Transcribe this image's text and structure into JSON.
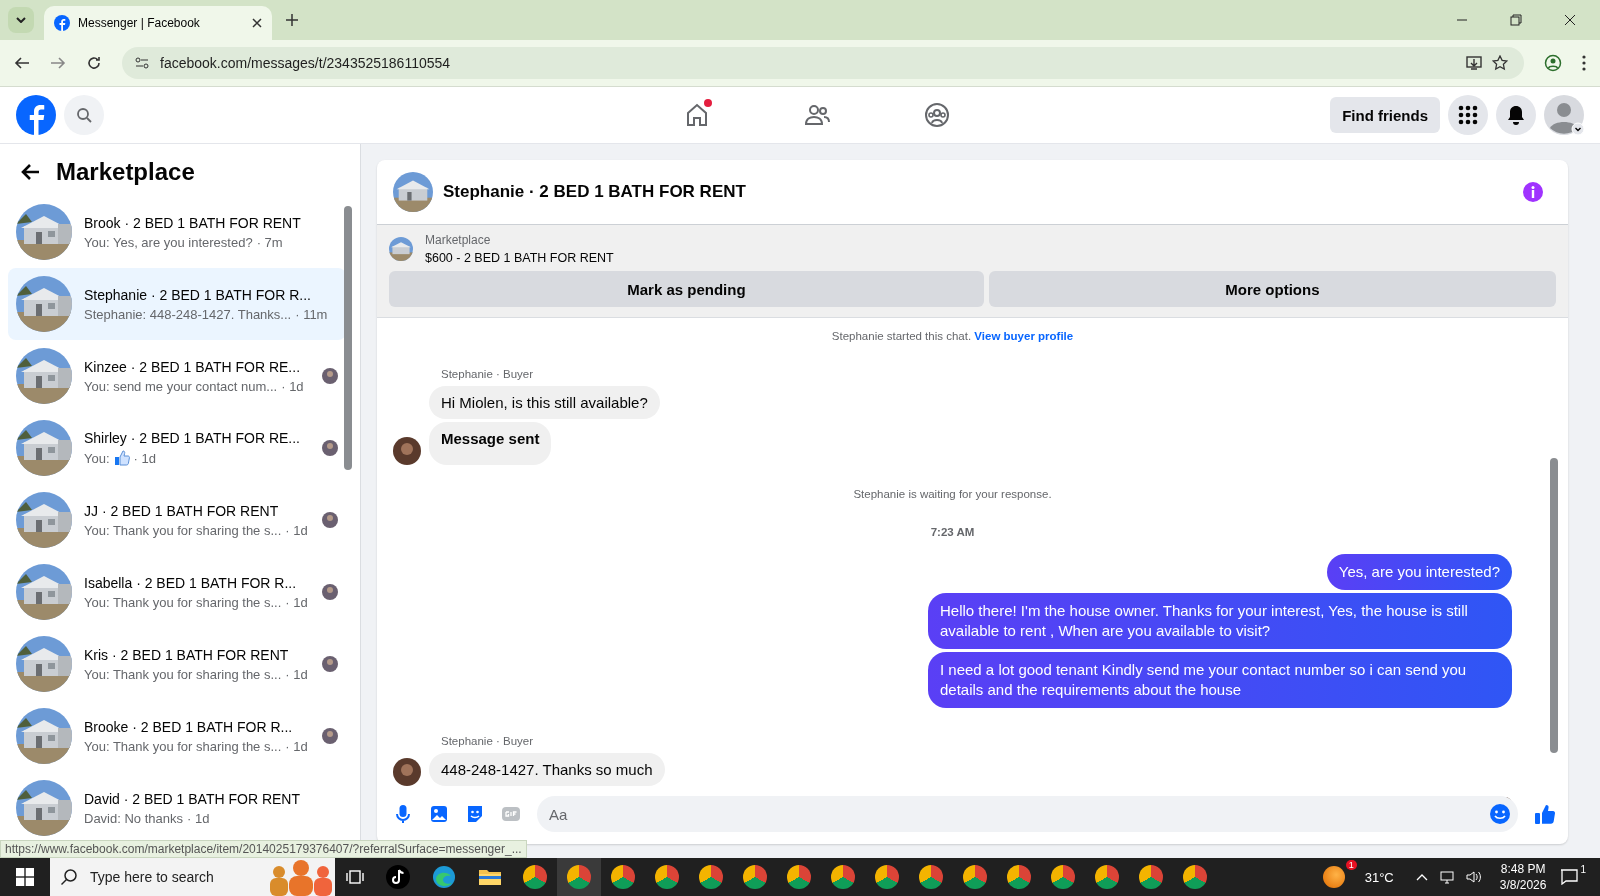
{
  "browser": {
    "tab_title": "Messenger | Facebook",
    "url": "facebook.com/messages/t/2343525186110554"
  },
  "header": {
    "home_badge": true,
    "find_friends": "Find friends"
  },
  "sidebar": {
    "title": "Marketplace",
    "conversations": [
      {
        "name": "Brook · 2 BED 1 BATH FOR RENT",
        "kind": "text",
        "preview": "You: Yes, are you interested?",
        "time": "· 7m",
        "selected": false,
        "seen": false
      },
      {
        "name": "Stephanie · 2 BED 1 BATH FOR R...",
        "kind": "text",
        "preview": "Stephanie: 448-248-1427. Thanks...",
        "time": "· 11m",
        "selected": true,
        "seen": false
      },
      {
        "name": "Kinzee · 2 BED 1 BATH FOR RE...",
        "kind": "text",
        "preview": "You: send me your contact num...",
        "time": "· 1d",
        "selected": false,
        "seen": true
      },
      {
        "name": "Shirley · 2 BED 1 BATH FOR RE...",
        "kind": "like",
        "preview": "You:",
        "time": "· 1d",
        "selected": false,
        "seen": true
      },
      {
        "name": "JJ · 2 BED 1 BATH FOR RENT",
        "kind": "text",
        "preview": "You: Thank you for sharing the s...",
        "time": "· 1d",
        "selected": false,
        "seen": true
      },
      {
        "name": "Isabella · 2 BED 1 BATH FOR R...",
        "kind": "text",
        "preview": "You: Thank you for sharing the s...",
        "time": "· 1d",
        "selected": false,
        "seen": true
      },
      {
        "name": "Kris · 2 BED 1 BATH FOR RENT",
        "kind": "text",
        "preview": "You: Thank you for sharing the s...",
        "time": "· 1d",
        "selected": false,
        "seen": true
      },
      {
        "name": "Brooke · 2 BED 1 BATH FOR R...",
        "kind": "text",
        "preview": "You: Thank you for sharing the s...",
        "time": "· 1d",
        "selected": false,
        "seen": true
      },
      {
        "name": "David · 2 BED 1 BATH FOR RENT",
        "kind": "text",
        "preview": "David: No thanks",
        "time": "· 1d",
        "selected": false,
        "seen": false
      }
    ]
  },
  "chat": {
    "title": "Stephanie · 2 BED 1 BATH FOR RENT",
    "listing_label": "Marketplace",
    "listing_title": "$600 - 2 BED 1 BATH FOR RENT",
    "buttons": [
      "Mark as pending",
      "More options"
    ],
    "notice": "Stephanie started this chat.",
    "notice_link": "View buyer profile",
    "messages": [
      {
        "kind": "sender",
        "text": "Stephanie · Buyer"
      },
      {
        "kind": "incoming",
        "text": "Hi Miolen, is this still available?",
        "bold": false,
        "avatar": false
      },
      {
        "kind": "incoming",
        "text": "Message sent",
        "bold": true,
        "avatar": true
      },
      {
        "kind": "system",
        "text": "Stephanie is waiting for your response."
      },
      {
        "kind": "time",
        "text": "7:23 AM"
      },
      {
        "kind": "outgoing",
        "text": "Yes, are you interested?"
      },
      {
        "kind": "outgoing",
        "text": "Hello there! I'm the house owner. Thanks for your interest, Yes, the house is still available to rent , When are you available to visit?"
      },
      {
        "kind": "outgoing",
        "text": "I need a lot good tenant Kindly send me your contact number so i can send you details and the requirements about the house"
      },
      {
        "kind": "sender",
        "text": "Stephanie · Buyer"
      },
      {
        "kind": "incoming",
        "text": "448-248-1427. Thanks so much",
        "bold": false,
        "avatar": true
      }
    ],
    "composer_placeholder": "Aa"
  },
  "status_url": "https://www.facebook.com/marketplace/item/2014025179376407/?referralSurface=messenger_...",
  "taskbar": {
    "search_placeholder": "Type here to search",
    "weather_badge": "1",
    "temperature": "31°C",
    "time": "8:48 PM",
    "date": "3/8/2026",
    "notifications": "1"
  }
}
